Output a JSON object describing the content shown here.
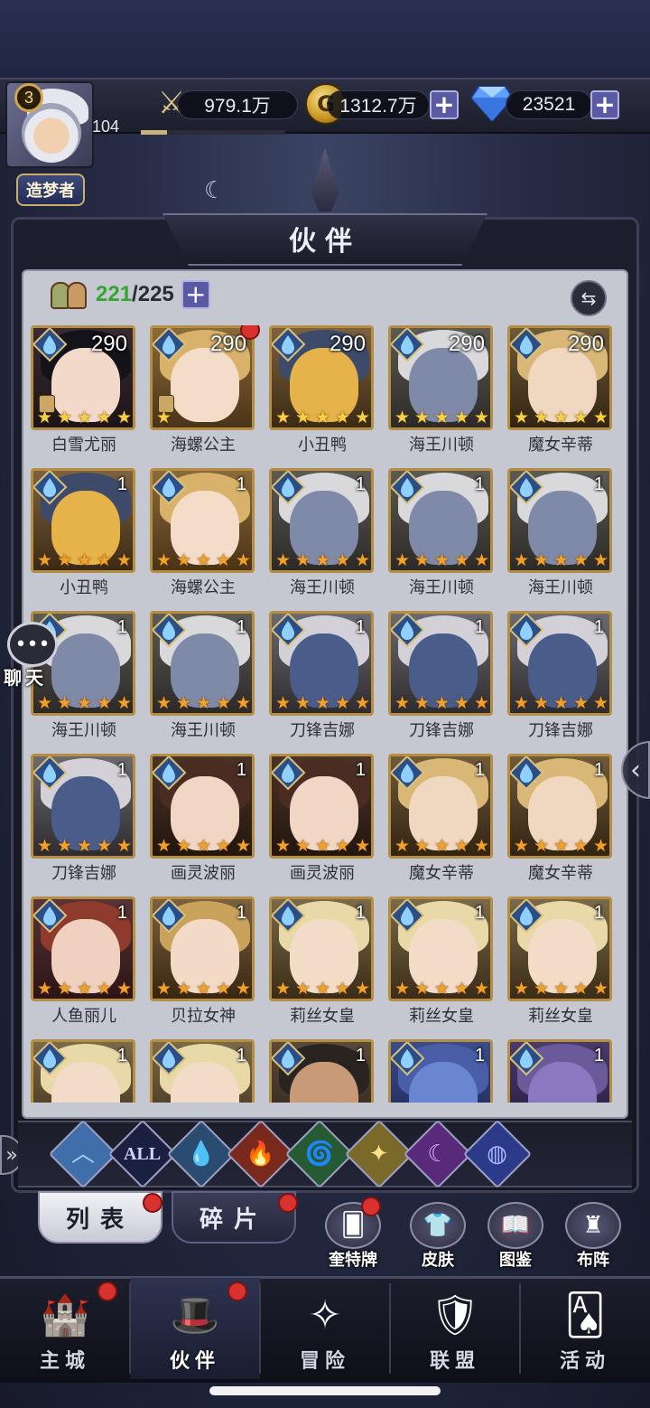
{
  "topbar": {
    "player_level": "3",
    "exp_value": "104",
    "title_badge": "造梦者",
    "combat_power": "979.1万",
    "gold": "1312.7万",
    "gems": "23521"
  },
  "panel": {
    "title": "伙伴",
    "hero_count_current": "221",
    "hero_count_max": "/225"
  },
  "heroes": [
    {
      "name": "白雪尤丽",
      "level": "290",
      "stars": 5,
      "star_color": "yellow",
      "skin": "dark"
    },
    {
      "name": "海螺公主",
      "level": "290",
      "stars": 1,
      "star_color": "yellow",
      "skin": "blonde",
      "reddot": true
    },
    {
      "name": "小丑鸭",
      "level": "290",
      "stars": 5,
      "star_color": "yellow",
      "skin": "duck"
    },
    {
      "name": "海王川顿",
      "level": "290",
      "stars": 5,
      "star_color": "yellow",
      "skin": "king"
    },
    {
      "name": "魔女辛蒂",
      "level": "290",
      "stars": 5,
      "star_color": "yellow",
      "skin": "witch"
    },
    {
      "name": "小丑鸭",
      "level": "1",
      "stars": 5,
      "star_color": "orange",
      "skin": "duck"
    },
    {
      "name": "海螺公主",
      "level": "1",
      "stars": 5,
      "star_color": "orange",
      "skin": "blonde"
    },
    {
      "name": "海王川顿",
      "level": "1",
      "stars": 5,
      "star_color": "orange",
      "skin": "king"
    },
    {
      "name": "海王川顿",
      "level": "1",
      "stars": 5,
      "star_color": "orange",
      "skin": "king"
    },
    {
      "name": "海王川顿",
      "level": "1",
      "stars": 5,
      "star_color": "orange",
      "skin": "king"
    },
    {
      "name": "海王川顿",
      "level": "1",
      "stars": 5,
      "star_color": "orange",
      "skin": "king"
    },
    {
      "name": "海王川顿",
      "level": "1",
      "stars": 5,
      "star_color": "orange",
      "skin": "king"
    },
    {
      "name": "刀锋吉娜",
      "level": "1",
      "stars": 5,
      "star_color": "orange",
      "skin": "mask"
    },
    {
      "name": "刀锋吉娜",
      "level": "1",
      "stars": 5,
      "star_color": "orange",
      "skin": "mask"
    },
    {
      "name": "刀锋吉娜",
      "level": "1",
      "stars": 5,
      "star_color": "orange",
      "skin": "mask"
    },
    {
      "name": "刀锋吉娜",
      "level": "1",
      "stars": 5,
      "star_color": "orange",
      "skin": "mask"
    },
    {
      "name": "画灵波丽",
      "level": "1",
      "stars": 5,
      "star_color": "orange",
      "skin": "brunette"
    },
    {
      "name": "画灵波丽",
      "level": "1",
      "stars": 5,
      "star_color": "orange",
      "skin": "brunette"
    },
    {
      "name": "魔女辛蒂",
      "level": "1",
      "stars": 5,
      "star_color": "orange",
      "skin": "witch"
    },
    {
      "name": "魔女辛蒂",
      "level": "1",
      "stars": 5,
      "star_color": "orange",
      "skin": "witch"
    },
    {
      "name": "人鱼丽儿",
      "level": "1",
      "stars": 5,
      "star_color": "orange",
      "skin": "redhair"
    },
    {
      "name": "贝拉女神",
      "level": "1",
      "stars": 5,
      "star_color": "orange",
      "skin": "goddess"
    },
    {
      "name": "莉丝女皇",
      "level": "1",
      "stars": 5,
      "star_color": "orange",
      "skin": "queen"
    },
    {
      "name": "莉丝女皇",
      "level": "1",
      "stars": 5,
      "star_color": "orange",
      "skin": "queen"
    },
    {
      "name": "莉丝女皇",
      "level": "1",
      "stars": 5,
      "star_color": "orange",
      "skin": "queen"
    },
    {
      "name": "",
      "level": "1",
      "stars": 0,
      "star_color": "orange",
      "skin": "queen"
    },
    {
      "name": "",
      "level": "1",
      "stars": 0,
      "star_color": "orange",
      "skin": "queen"
    },
    {
      "name": "",
      "level": "1",
      "stars": 0,
      "star_color": "orange",
      "skin": "pirate"
    },
    {
      "name": "",
      "level": "1",
      "stars": 0,
      "star_color": "orange",
      "skin": "beast"
    },
    {
      "name": "",
      "level": "1",
      "stars": 0,
      "star_color": "orange",
      "skin": "owl"
    }
  ],
  "filters": [
    {
      "id": "up",
      "glyph": "︿",
      "color": "#3f6ea8",
      "text_color": "#9fd0ff"
    },
    {
      "id": "all",
      "glyph": "ALL",
      "color": "#1b2040",
      "text_color": "#cfd3ff"
    },
    {
      "id": "water",
      "glyph": "💧",
      "color": "#2a4c70",
      "text_color": "#8ecbff"
    },
    {
      "id": "fire",
      "glyph": "🔥",
      "color": "#7a2a1c",
      "text_color": "#ff8a4a"
    },
    {
      "id": "wind",
      "glyph": "🌀",
      "color": "#265a32",
      "text_color": "#7fe38a"
    },
    {
      "id": "light",
      "glyph": "✦",
      "color": "#7a6a2a",
      "text_color": "#ffe38a"
    },
    {
      "id": "dark",
      "glyph": "☾",
      "color": "#5a2a7a",
      "text_color": "#e2a8ff"
    },
    {
      "id": "cosmic",
      "glyph": "◍",
      "color": "#2c3a8a",
      "text_color": "#a8b8ff"
    }
  ],
  "tabs": {
    "list": "列表",
    "fragments": "碎片"
  },
  "sub_buttons": [
    {
      "label": "奎特牌",
      "glyph": "🂠",
      "reddot": true
    },
    {
      "label": "皮肤",
      "glyph": "👕",
      "reddot": false
    },
    {
      "label": "图鉴",
      "glyph": "📖",
      "reddot": false
    },
    {
      "label": "布阵",
      "glyph": "♜",
      "reddot": false
    }
  ],
  "nav": [
    {
      "label": "主城",
      "glyph": "🏰",
      "reddot": true,
      "active": false
    },
    {
      "label": "伙伴",
      "glyph": "🎩",
      "reddot": true,
      "active": true
    },
    {
      "label": "冒险",
      "glyph": "✧",
      "reddot": false,
      "active": false
    },
    {
      "label": "联盟",
      "glyph": "🛡",
      "reddot": false,
      "active": false
    },
    {
      "label": "活动",
      "glyph": "🂡",
      "reddot": false,
      "active": false
    }
  ],
  "chat": {
    "label": "聊天"
  },
  "colors": {
    "accent": "#5a5aa2",
    "reddot": "#d8312e",
    "gold_frame": "#b58e43",
    "count_green": "#37a331"
  }
}
